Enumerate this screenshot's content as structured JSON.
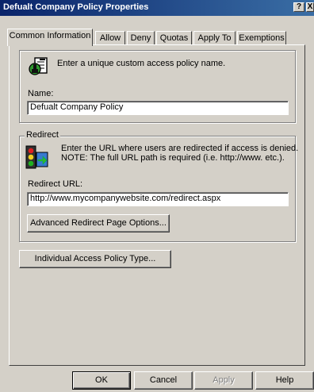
{
  "window": {
    "title": "Defualt Company Policy Properties",
    "help_label": "?",
    "close_label": "X"
  },
  "tabs": [
    {
      "label": "Common Information",
      "active": true
    },
    {
      "label": "Allow"
    },
    {
      "label": "Deny"
    },
    {
      "label": "Quotas"
    },
    {
      "label": "Apply To"
    },
    {
      "label": "Exemptions"
    }
  ],
  "policy_name": {
    "description": "Enter a unique custom access policy name.",
    "name_label": "Name:",
    "name_value": "Defualt Company Policy"
  },
  "redirect": {
    "group_label": "Redirect",
    "description_line1": "Enter the URL where users are redirected if access is denied.",
    "description_line2": "NOTE: The full URL path is required (i.e. http://www. etc.).",
    "url_label": "Redirect URL:",
    "url_value": "http://www.mycompanywebsite.com/redirect.aspx",
    "advanced_button": "Advanced Redirect Page Options..."
  },
  "individual_button": "Individual Access Policy Type...",
  "footer": {
    "ok": "OK",
    "cancel": "Cancel",
    "apply": "Apply",
    "help": "Help"
  },
  "icons": {
    "policy": "policy-document-icon",
    "redirect": "traffic-light-redirect-icon"
  }
}
